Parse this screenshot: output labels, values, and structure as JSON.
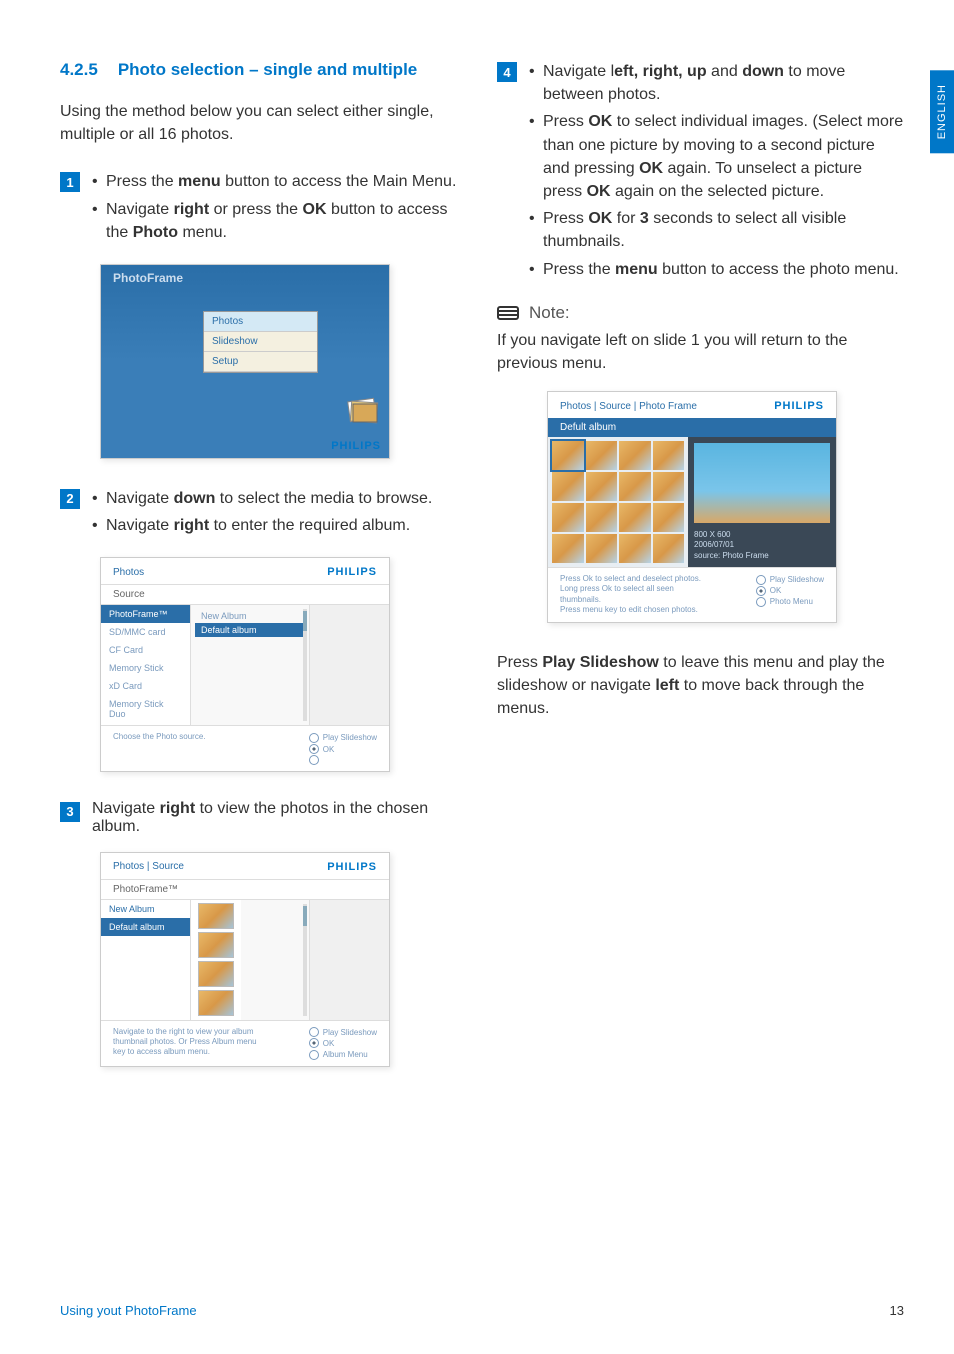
{
  "sideTab": "ENGLISH",
  "heading": {
    "num": "4.2.5",
    "text": "Photo selection – single and multiple"
  },
  "intro": "Using the method below you can select either single, multiple or all 16 photos.",
  "step1": {
    "a_pre": "Press the ",
    "a_b": "menu",
    "a_post": " button to access the Main Menu.",
    "b_pre": "Navigate ",
    "b_b1": "right",
    "b_mid": " or press the ",
    "b_b2": "OK",
    "b_post": " button to access the ",
    "b_b3": "Photo",
    "b_end": " menu."
  },
  "shot1": {
    "topbar": "PhotoFrame",
    "menu": [
      "Photos",
      "Slideshow",
      "Setup"
    ],
    "brand": "PHILIPS"
  },
  "step2": {
    "a_pre": "Navigate ",
    "a_b": "down",
    "a_post": " to select the media to browse.",
    "b_pre": "Navigate ",
    "b_b": "right",
    "b_post": " to enter the required album."
  },
  "shot2": {
    "breadcrumb": "Photos",
    "sub": "Source",
    "leftItems": [
      "PhotoFrame™",
      "SD/MMC card",
      "CF Card",
      "Memory Stick",
      "xD Card",
      "Memory Stick Duo"
    ],
    "midItems": [
      "New Album",
      "Default album"
    ],
    "footLeft": "Choose the Photo source.",
    "fr1": "Play Slideshow",
    "fr2": "OK",
    "brand": "PHILIPS"
  },
  "step3": {
    "pre": "Navigate ",
    "b": "right",
    "post": " to view the photos in the chosen album."
  },
  "shot3": {
    "breadcrumb": "Photos | Source",
    "sub": "PhotoFrame™",
    "leftItems": [
      "New Album",
      "Default album"
    ],
    "footLeft": "Navigate to the right to view your album thumbnail photos. Or Press Album menu key to access album menu.",
    "fr1": "Play Slideshow",
    "fr2": "OK",
    "fr3": "Album Menu",
    "brand": "PHILIPS"
  },
  "step4": {
    "a_pre": "Navigate l",
    "a_b1": "eft, right, up",
    "a_mid": " and ",
    "a_b2": "down",
    "a_post": " to move between photos.",
    "b_pre": "Press ",
    "b_b1": "OK",
    "b_mid1": " to select individual images. (Select more than one picture by moving to a second picture and pressing ",
    "b_b2": "OK",
    "b_mid2": " again. To unselect a picture press ",
    "b_b3": "OK",
    "b_post": " again on the selected picture.",
    "c_pre": "Press ",
    "c_b1": "OK",
    "c_mid": " for ",
    "c_b2": "3",
    "c_post": " seconds to select all visible thumbnails.",
    "d_pre": "Press the ",
    "d_b": "menu",
    "d_post": " button to access the photo menu."
  },
  "note": {
    "label": "Note:",
    "text": "If you navigate left on slide 1 you will return to the previous menu."
  },
  "shot4": {
    "breadcrumb": "Photos | Source | Photo Frame",
    "sub": "Defult album",
    "meta1": "800 X 600",
    "meta2": "2006/07/01",
    "meta3": "source: Photo Frame",
    "footLeft": "Press Ok to select and deselect photos.\nLong press Ok to select all seen thumbnails.\nPress menu key to edit chosen photos.",
    "fr1": "Play Slideshow",
    "fr2": "OK",
    "fr3": "Photo Menu",
    "brand": "PHILIPS"
  },
  "bottom": {
    "pre": "Press ",
    "b1": "Play Slideshow",
    "mid": " to leave this menu and play the slideshow or navigate ",
    "b2": "left",
    "post": " to move back through the menus."
  },
  "footer": {
    "left": "Using yout PhotoFrame",
    "right": "13"
  }
}
